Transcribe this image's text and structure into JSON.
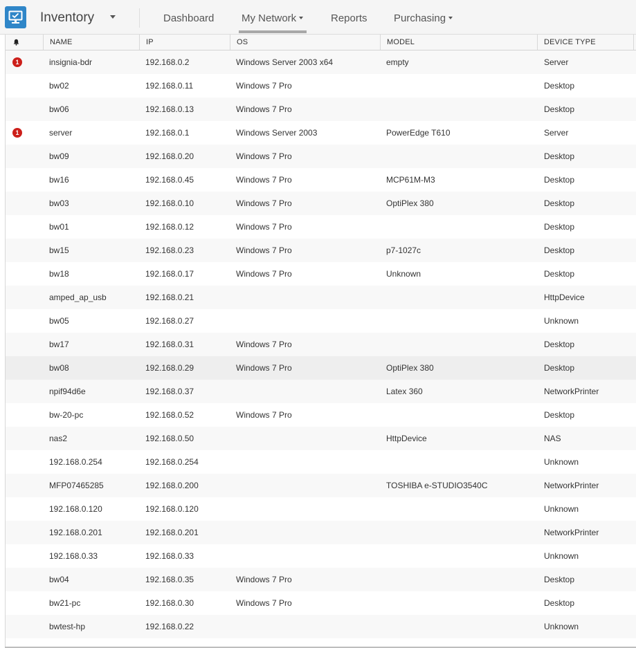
{
  "app": {
    "title": "Inventory",
    "accent_color": "#2f86c8",
    "icon": "monitor-icon"
  },
  "nav": {
    "items": [
      {
        "label": "Dashboard",
        "has_dropdown": false,
        "active": false
      },
      {
        "label": "My Network",
        "has_dropdown": true,
        "active": true
      },
      {
        "label": "Reports",
        "has_dropdown": false,
        "active": false
      },
      {
        "label": "Purchasing",
        "has_dropdown": true,
        "active": false
      }
    ]
  },
  "table": {
    "alert_column_icon": "bell-icon",
    "columns": [
      "NAME",
      "IP",
      "OS",
      "MODEL",
      "DEVICE TYPE"
    ],
    "alert_badge_color": "#cc1f1a",
    "rows": [
      {
        "alert": "1",
        "name": "insignia-bdr",
        "ip": "192.168.0.2",
        "os": "Windows Server 2003 x64",
        "model": "empty",
        "type": "Server"
      },
      {
        "alert": "",
        "name": "bw02",
        "ip": "192.168.0.11",
        "os": "Windows 7 Pro",
        "model": "",
        "type": "Desktop"
      },
      {
        "alert": "",
        "name": "bw06",
        "ip": "192.168.0.13",
        "os": "Windows 7 Pro",
        "model": "",
        "type": "Desktop"
      },
      {
        "alert": "1",
        "name": "server",
        "ip": "192.168.0.1",
        "os": "Windows Server 2003",
        "model": "PowerEdge T610",
        "type": "Server"
      },
      {
        "alert": "",
        "name": "bw09",
        "ip": "192.168.0.20",
        "os": "Windows 7 Pro",
        "model": "",
        "type": "Desktop"
      },
      {
        "alert": "",
        "name": "bw16",
        "ip": "192.168.0.45",
        "os": "Windows 7 Pro",
        "model": "MCP61M-M3",
        "type": "Desktop"
      },
      {
        "alert": "",
        "name": "bw03",
        "ip": "192.168.0.10",
        "os": "Windows 7 Pro",
        "model": "OptiPlex 380",
        "type": "Desktop"
      },
      {
        "alert": "",
        "name": "bw01",
        "ip": "192.168.0.12",
        "os": "Windows 7 Pro",
        "model": "",
        "type": "Desktop"
      },
      {
        "alert": "",
        "name": "bw15",
        "ip": "192.168.0.23",
        "os": "Windows 7 Pro",
        "model": "p7-1027c",
        "type": "Desktop"
      },
      {
        "alert": "",
        "name": "bw18",
        "ip": "192.168.0.17",
        "os": "Windows 7 Pro",
        "model": "Unknown",
        "type": "Desktop"
      },
      {
        "alert": "",
        "name": "amped_ap_usb",
        "ip": "192.168.0.21",
        "os": "",
        "model": "",
        "type": "HttpDevice"
      },
      {
        "alert": "",
        "name": "bw05",
        "ip": "192.168.0.27",
        "os": "",
        "model": "",
        "type": "Unknown"
      },
      {
        "alert": "",
        "name": "bw17",
        "ip": "192.168.0.31",
        "os": "Windows 7 Pro",
        "model": "",
        "type": "Desktop"
      },
      {
        "alert": "",
        "name": "bw08",
        "ip": "192.168.0.29",
        "os": "Windows 7 Pro",
        "model": "OptiPlex 380",
        "type": "Desktop",
        "highlight": true
      },
      {
        "alert": "",
        "name": "npif94d6e",
        "ip": "192.168.0.37",
        "os": "",
        "model": "Latex 360",
        "type": "NetworkPrinter"
      },
      {
        "alert": "",
        "name": "bw-20-pc",
        "ip": "192.168.0.52",
        "os": "Windows 7 Pro",
        "model": "",
        "type": "Desktop"
      },
      {
        "alert": "",
        "name": "nas2",
        "ip": "192.168.0.50",
        "os": "",
        "model": "HttpDevice",
        "type": "NAS"
      },
      {
        "alert": "",
        "name": "192.168.0.254",
        "ip": "192.168.0.254",
        "os": "",
        "model": "",
        "type": "Unknown"
      },
      {
        "alert": "",
        "name": "MFP07465285",
        "ip": "192.168.0.200",
        "os": "",
        "model": "TOSHIBA e-STUDIO3540C",
        "type": "NetworkPrinter"
      },
      {
        "alert": "",
        "name": "192.168.0.120",
        "ip": "192.168.0.120",
        "os": "",
        "model": "",
        "type": "Unknown"
      },
      {
        "alert": "",
        "name": "192.168.0.201",
        "ip": "192.168.0.201",
        "os": "",
        "model": "",
        "type": "NetworkPrinter"
      },
      {
        "alert": "",
        "name": "192.168.0.33",
        "ip": "192.168.0.33",
        "os": "",
        "model": "",
        "type": "Unknown"
      },
      {
        "alert": "",
        "name": "bw04",
        "ip": "192.168.0.35",
        "os": "Windows 7 Pro",
        "model": "",
        "type": "Desktop"
      },
      {
        "alert": "",
        "name": "bw21-pc",
        "ip": "192.168.0.30",
        "os": "Windows 7 Pro",
        "model": "",
        "type": "Desktop"
      },
      {
        "alert": "",
        "name": "bwtest-hp",
        "ip": "192.168.0.22",
        "os": "",
        "model": "",
        "type": "Unknown"
      }
    ]
  }
}
